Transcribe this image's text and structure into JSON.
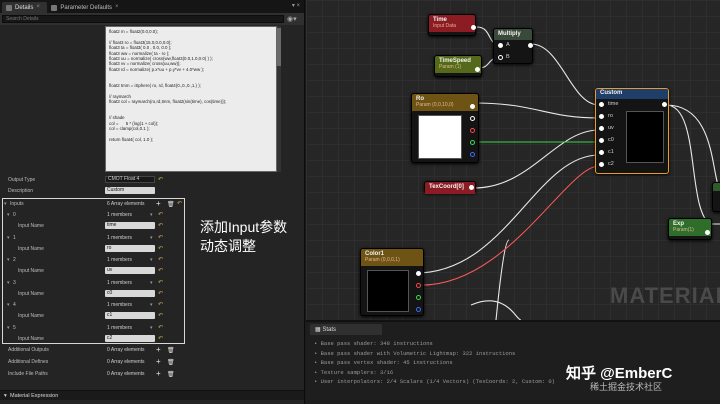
{
  "details": {
    "tab_details": "Details",
    "tab_params": "Parameter Defaults",
    "search_placeholder": "Search Details",
    "code_lines": [
      "float2 m = float2(0.0,0.0);",
      "",
      "// float3 ro = float3(15.0,0.0,0.0);",
      "float3 ta = float3( 0.0 , 0.0, 0.0 );",
      "float3 ww = normalize( ta - ro );",
      "float3 uu = normalize( cross(ww,float3(0.0,1.0,0.0) ) );",
      "float3 vv = normalize( cross(uu,ww));",
      "float3 rd = normalize( p.x*uu + p.y*vv + 4.0*ww );",
      "",
      "",
      "float2 tmm = iSphere( ro, rd, float4(0.,0.,0.,1.) );",
      "",
      "// raymarch",
      "float3 col = raymarch(ro,rd,tmm, float2(sin(time), cos(time)));",
      "",
      "",
      "// shade",
      "col =      5 * (log(1 + col));",
      "col = clamp(col,0.1 );",
      "",
      "return float4( col, 1.0 );"
    ],
    "output_type_label": "Output Type",
    "output_type_value": "CMOT Float 4",
    "description_label": "Description",
    "description_value": "Custom",
    "inputs_label": "Inputs",
    "inputs_count": "6 Array elements",
    "inputs": [
      {
        "index": "0",
        "members": "1 members",
        "name_label": "Input Name",
        "name": "time"
      },
      {
        "index": "1",
        "members": "1 members",
        "name_label": "Input Name",
        "name": "ro"
      },
      {
        "index": "2",
        "members": "1 members",
        "name_label": "Input Name",
        "name": "uv"
      },
      {
        "index": "3",
        "members": "1 members",
        "name_label": "Input Name",
        "name": "c0"
      },
      {
        "index": "4",
        "members": "1 members",
        "name_label": "Input Name",
        "name": "c1"
      },
      {
        "index": "5",
        "members": "1 members",
        "name_label": "Input Name",
        "name": "c2"
      }
    ],
    "additional_outputs_label": "Additional Outputs",
    "additional_outputs_value": "0 Array elements",
    "additional_defines_label": "Additional Defines",
    "additional_defines_value": "0 Array elements",
    "include_paths_label": "Include File Paths",
    "include_paths_value": "0 Array elements",
    "material_expression_label": "Material Expression"
  },
  "annotation": {
    "line1": "添加Input参数",
    "line2": "动态调整"
  },
  "graph": {
    "time_title": "Time",
    "time_sub": "Input Data",
    "multiply_title": "Multiply",
    "multiply_a": "A",
    "multiply_b": "B",
    "timespeed_title": "TimeSpeed",
    "timespeed_sub": "Param (1)",
    "ro_title": "Ro",
    "ro_sub": "Param (0,0,10,0)",
    "texcoord_title": "TexCoord[0]",
    "custom_title": "Custom",
    "custom_pins": [
      "time",
      "ro",
      "uv",
      "c0",
      "c1",
      "c2"
    ],
    "color1_title": "Color1",
    "color1_sub": "Param (0,0,0,1)",
    "exp_title": "Exp",
    "exp_sub": "Param(1)",
    "watermark": "MATERIAL",
    "brand": "知乎 @EmberC",
    "brand_sub": "稀土掘金技术社区"
  },
  "stats": {
    "tab": "Stats",
    "lines": [
      "Base pass shader: 348 instructions",
      "Base pass shader with Volumetric Lightmap: 322 instructions",
      "Base pass vertex shader: 45 instructions",
      "Texture samplers: 3/16",
      "User interpolators: 2/4 Scalars (1/4 Vectors) (TexCoords: 2, Custom: 0)"
    ]
  },
  "colors": {
    "accent_orange": "#e89a2e",
    "time_header": "#8c1c24",
    "param_header": "#546a1a",
    "ro_header": "#6e5414",
    "texcoord_header": "#8c1c24",
    "custom_header": "#1f3f6a",
    "exp_header": "#2f6e2a"
  }
}
